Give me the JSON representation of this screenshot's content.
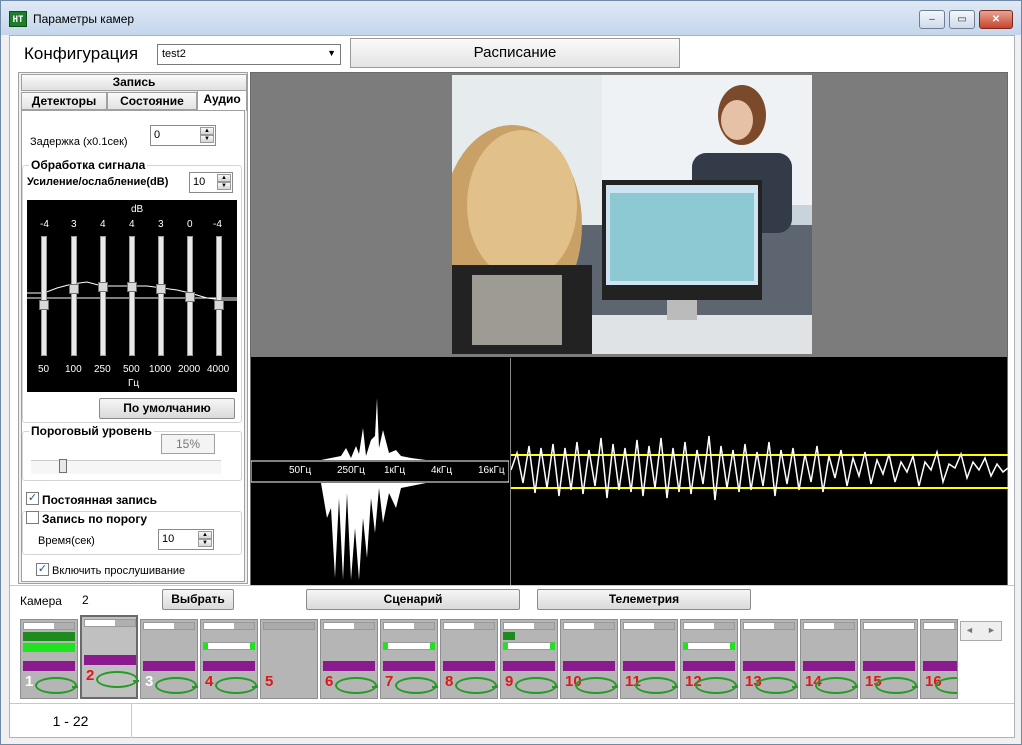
{
  "window": {
    "title": "Параметры камер",
    "icon": "НТ",
    "minimize": "‒",
    "maximize": "▭",
    "close": "✕"
  },
  "config": {
    "label": "Конфигурация",
    "selected": "test2"
  },
  "schedule_tab": "Расписание",
  "record": {
    "header": "Запись",
    "tabs": [
      "Детекторы",
      "Состояние",
      "Аудио"
    ],
    "delay_label": "Задержка (x0.1сек)",
    "delay_value": "0",
    "signal_group": "Обработка сигнала",
    "gain_label": "Усиление/ослабление(dB)",
    "gain_value": "10",
    "eq": {
      "db_label": "dB",
      "hz_label": "Гц",
      "gains": [
        "-4",
        "3",
        "4",
        "4",
        "3",
        "0",
        "-4"
      ],
      "freqs": [
        "50",
        "100",
        "250",
        "500",
        "1000",
        "2000",
        "4000"
      ]
    },
    "default_button": "По умолчанию",
    "threshold_group": "Пороговый уровень",
    "threshold_value": "15%",
    "constant_record": "Постоянная запись",
    "threshold_record": "Запись по порогу",
    "time_label": "Время(сек)",
    "time_value": "10",
    "listen": "Включить прослушивание"
  },
  "spectrum_labels": [
    "50Гц",
    "250Гц",
    "1кГц",
    "4кГц",
    "16кГц"
  ],
  "controls": {
    "camera_label": "Камера",
    "camera_value": "2",
    "select_button": "Выбрать",
    "scenario_button": "Сценарий",
    "telemetry_button": "Телеметрия"
  },
  "thumbnails": [
    "1",
    "2",
    "3",
    "4",
    "5",
    "6",
    "7",
    "8",
    "9",
    "10",
    "11",
    "12",
    "13",
    "14",
    "15",
    "16"
  ],
  "footer": {
    "range": "1 - 22"
  },
  "colors": {
    "accent_green": "#239b24",
    "purple": "#8a1a8e",
    "number_red": "#e0161a",
    "wave_yellow": "#ffff00"
  }
}
